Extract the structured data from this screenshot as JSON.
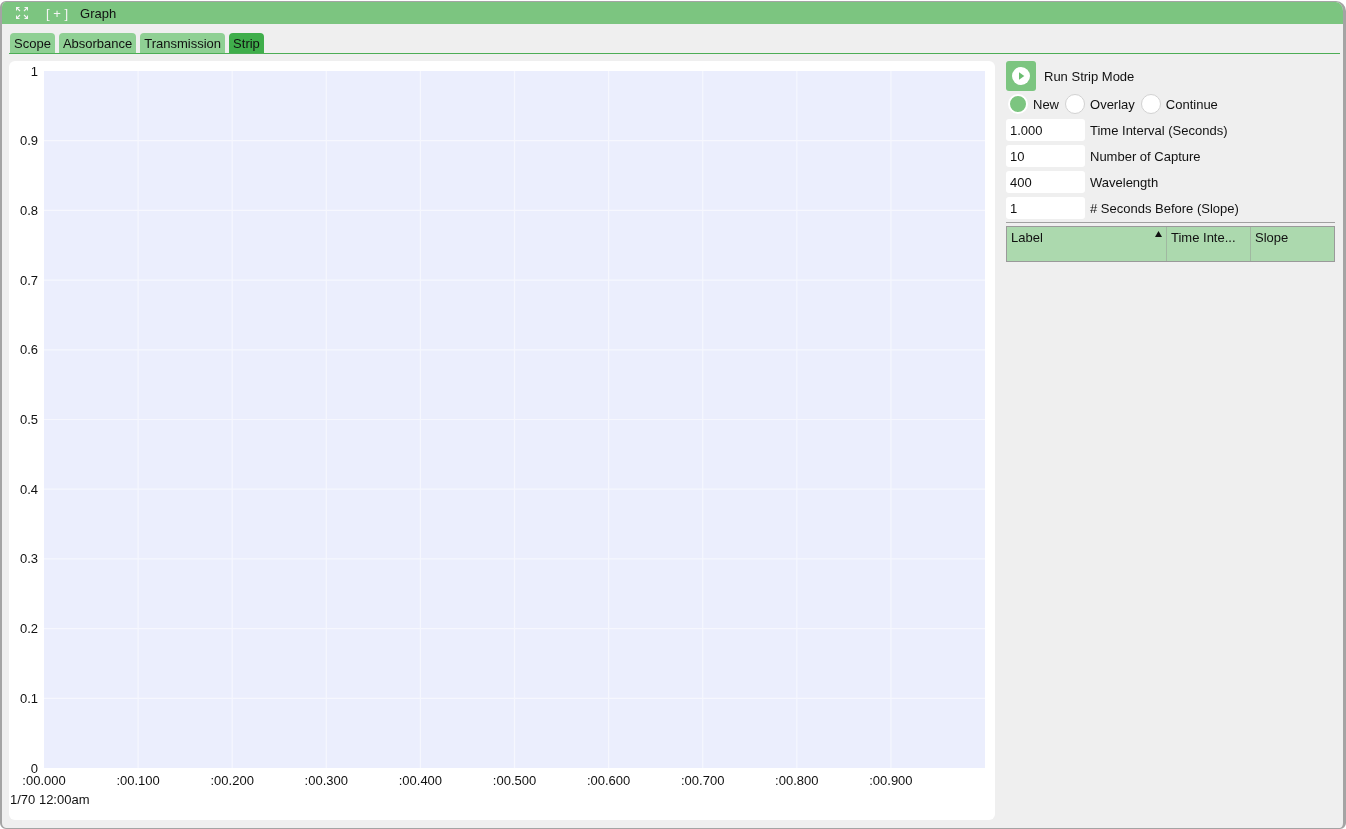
{
  "window": {
    "title": "Graph",
    "add_button": "[ + ]"
  },
  "tabs": [
    {
      "label": "Scope",
      "selected": false
    },
    {
      "label": "Absorbance",
      "selected": false
    },
    {
      "label": "Transmission",
      "selected": false
    },
    {
      "label": "Strip",
      "selected": true
    }
  ],
  "chart": {
    "date_label": "1/70 12:00am",
    "chart_data": {
      "type": "line",
      "grid": true,
      "xlim": [
        0,
        1
      ],
      "ylim": [
        0,
        1
      ],
      "xticks": [
        {
          "value": 0,
          "label": ":00.000"
        },
        {
          "value": 0.1,
          "label": ":00.100"
        },
        {
          "value": 0.2,
          "label": ":00.200"
        },
        {
          "value": 0.3,
          "label": ":00.300"
        },
        {
          "value": 0.4,
          "label": ":00.400"
        },
        {
          "value": 0.5,
          "label": ":00.500"
        },
        {
          "value": 0.6,
          "label": ":00.600"
        },
        {
          "value": 0.7,
          "label": ":00.700"
        },
        {
          "value": 0.8,
          "label": ":00.800"
        },
        {
          "value": 0.9,
          "label": ":00.900"
        }
      ],
      "yticks": [
        0,
        0.1,
        0.2,
        0.3,
        0.4,
        0.5,
        0.6,
        0.7,
        0.8,
        0.9,
        1
      ]
    }
  },
  "strip_panel": {
    "run_button": {
      "label": "Run Strip Mode"
    },
    "modes": [
      {
        "label": "New",
        "selected": true
      },
      {
        "label": "Overlay",
        "selected": false
      },
      {
        "label": "Continue",
        "selected": false
      }
    ],
    "fields": [
      {
        "value": "1.000",
        "label": "Time Interval (Seconds)"
      },
      {
        "value": "10",
        "label": "Number of Capture"
      },
      {
        "value": "400",
        "label": "Wavelength"
      },
      {
        "value": "1",
        "label": "# Seconds Before (Slope)"
      }
    ],
    "table": {
      "columns": [
        {
          "label": "Label",
          "sorted": true
        },
        {
          "label": "Time Inte...",
          "sorted": false
        },
        {
          "label": "Slope",
          "sorted": false
        }
      ]
    }
  }
}
